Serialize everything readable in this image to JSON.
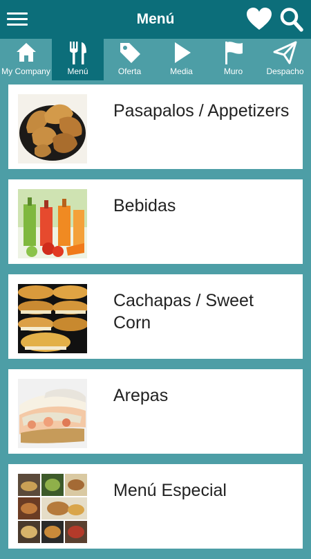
{
  "header": {
    "title": "Menú",
    "icons": [
      "hamburger-menu-icon",
      "heart-icon",
      "search-icon"
    ]
  },
  "tabs": [
    {
      "label": "My Company",
      "icon": "home-icon",
      "active": false
    },
    {
      "label": "Menú",
      "icon": "fork-knife-icon",
      "active": true
    },
    {
      "label": "Oferta",
      "icon": "tag-icon",
      "active": false
    },
    {
      "label": "Media",
      "icon": "play-icon",
      "active": false
    },
    {
      "label": "Muro",
      "icon": "flag-icon",
      "active": false
    },
    {
      "label": "Despacho",
      "icon": "send-icon",
      "active": false
    }
  ],
  "categories": [
    {
      "name": "Pasapalos / Appetizers"
    },
    {
      "name": "Bebidas"
    },
    {
      "name": "Cachapas / Sweet Corn"
    },
    {
      "name": "Arepas"
    },
    {
      "name": "Menú Especial"
    }
  ],
  "colors": {
    "appbar": "#0c6e7a",
    "background": "#4d9ea6",
    "card": "#ffffff"
  }
}
